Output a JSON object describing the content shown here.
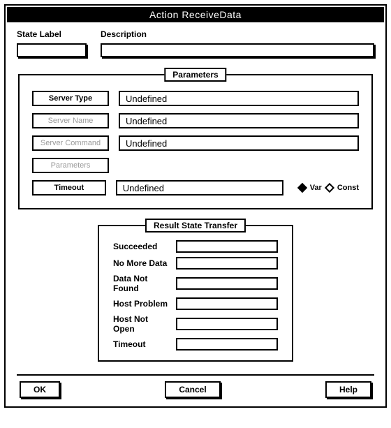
{
  "window": {
    "title": "Action ReceiveData"
  },
  "top": {
    "state_label_text": "State Label",
    "state_value": "",
    "description_text": "Description",
    "description_value": ""
  },
  "parameters": {
    "group_title": "Parameters",
    "rows": [
      {
        "label": "Server Type",
        "value": "Undefined",
        "disabled": false,
        "has_value": true
      },
      {
        "label": "Server Name",
        "value": "Undefined",
        "disabled": true,
        "has_value": true
      },
      {
        "label": "Server Command",
        "value": "Undefined",
        "disabled": true,
        "has_value": true
      },
      {
        "label": "Parameters",
        "value": "",
        "disabled": true,
        "has_value": false
      },
      {
        "label": "Timeout",
        "value": "Undefined",
        "disabled": false,
        "has_value": true
      }
    ],
    "legend": {
      "var": "Var",
      "const": "Const"
    }
  },
  "results": {
    "group_title": "Result State Transfer",
    "rows": [
      {
        "label": "Succeeded",
        "value": ""
      },
      {
        "label": "No More Data",
        "value": ""
      },
      {
        "label": "Data Not Found",
        "value": ""
      },
      {
        "label": "Host Problem",
        "value": ""
      },
      {
        "label": "Host Not Open",
        "value": ""
      },
      {
        "label": "Timeout",
        "value": ""
      }
    ]
  },
  "buttons": {
    "ok": "OK",
    "cancel": "Cancel",
    "help": "Help"
  }
}
